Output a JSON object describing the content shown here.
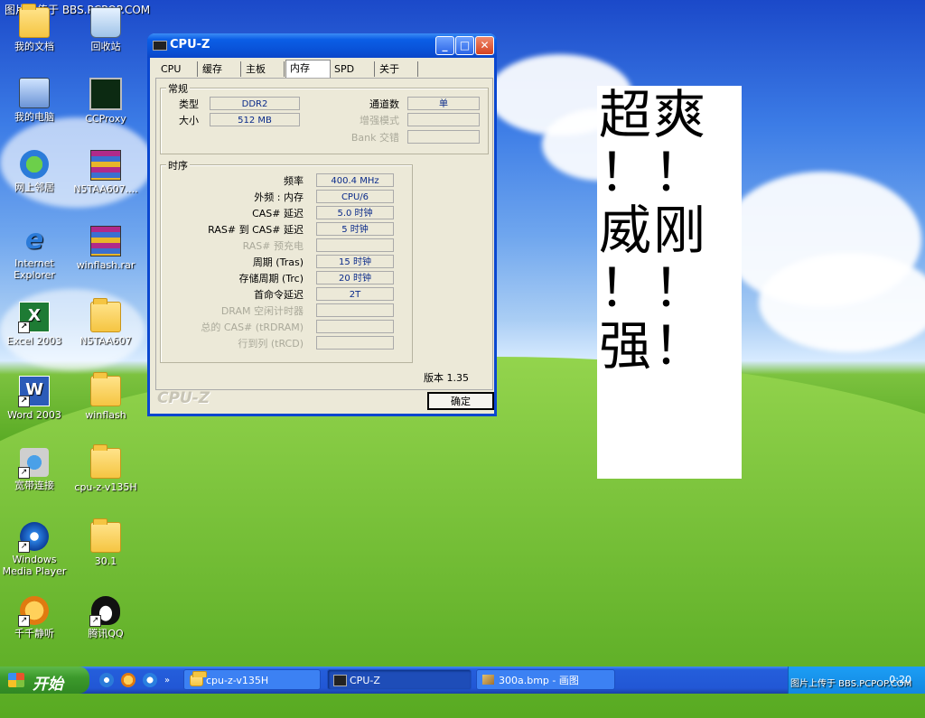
{
  "watermark_top": "图片上传于 BBS.PCPOP.COM",
  "desktop_icons": [
    {
      "label": "我的文档",
      "icon": "my-documents-icon"
    },
    {
      "label": "CCProxy",
      "icon": "ccproxy-icon"
    },
    {
      "label": "我的电脑",
      "icon": "my-computer-icon"
    },
    {
      "label": "N5TAA607....",
      "icon": "rar-archive-icon"
    },
    {
      "label": "网上邻居",
      "icon": "network-places-icon"
    },
    {
      "label": "winflash.rar",
      "icon": "rar-archive-icon"
    },
    {
      "label": "Internet Explorer",
      "icon": "internet-explorer-icon"
    },
    {
      "label": "N5TAA607",
      "icon": "folder-icon"
    },
    {
      "label": "Excel 2003",
      "icon": "excel-icon"
    },
    {
      "label": "winflash",
      "icon": "folder-icon"
    },
    {
      "label": "Word 2003",
      "icon": "word-icon"
    },
    {
      "label": "cpu-z-v135H",
      "icon": "folder-icon"
    },
    {
      "label": "宽带连接",
      "icon": "broadband-connection-icon"
    },
    {
      "label": "30.1",
      "icon": "folder-icon"
    },
    {
      "label": "Windows Media Player",
      "icon": "media-player-icon"
    },
    {
      "label": "腾讯QQ",
      "icon": "qq-penguin-icon"
    },
    {
      "label": "千千静听",
      "icon": "ttplayer-icon"
    },
    {
      "label": "回收站",
      "icon": "recycle-bin-icon"
    }
  ],
  "cpuz": {
    "title": "CPU-Z",
    "tabs": [
      "CPU",
      "缓存",
      "主板",
      "内存",
      "SPD",
      "关于"
    ],
    "active_tab": "内存",
    "general": {
      "group_label": "常规",
      "type_label": "类型",
      "type_value": "DDR2",
      "size_label": "大小",
      "size_value": "512 MB",
      "channels_label": "通道数",
      "channels_value": "单",
      "perf_mode_label": "增强模式",
      "perf_mode_value": "",
      "bank_label": "Bank 交错",
      "bank_value": ""
    },
    "timings": {
      "group_label": "时序",
      "rows": [
        {
          "label": "频率",
          "value": "400.4 MHz",
          "dim": false
        },
        {
          "label": "外频 : 内存",
          "value": "CPU/6",
          "dim": false
        },
        {
          "label": "CAS# 延迟",
          "value": "5.0 时钟",
          "dim": false
        },
        {
          "label": "RAS# 到 CAS# 延迟",
          "value": "5 时钟",
          "dim": false
        },
        {
          "label": "RAS# 预充电",
          "value": "",
          "dim": true
        },
        {
          "label": "周期 (Tras)",
          "value": "15 时钟",
          "dim": false
        },
        {
          "label": "存储周期 (Trc)",
          "value": "20 时钟",
          "dim": false
        },
        {
          "label": "首命令延迟",
          "value": "2T",
          "dim": false
        },
        {
          "label": "DRAM 空闲计时器",
          "value": "",
          "dim": true
        },
        {
          "label": "总的 CAS# (tRDRAM)",
          "value": "",
          "dim": true
        },
        {
          "label": "行到列 (tRCD)",
          "value": "",
          "dim": true
        }
      ]
    },
    "version": "版本 1.35",
    "logo": "CPU-Z",
    "ok_label": "确定"
  },
  "paint_text": [
    "超爽",
    "！！",
    "威刚",
    "！！",
    "强！"
  ],
  "taskbar": {
    "start_label": "开始",
    "tasks": [
      {
        "label": "cpu-z-v135H",
        "icon": "folder-icon",
        "active": false
      },
      {
        "label": "CPU-Z",
        "icon": "chip-icon",
        "active": true
      },
      {
        "label": "300a.bmp - 画图",
        "icon": "paint-icon",
        "active": false
      }
    ],
    "tray_watermark": "图片上传于 BBS.PCPOP.COM",
    "clock": "0:20"
  },
  "colors": {
    "title_blue": "#0a47d0",
    "taskbar_blue": "#245edb",
    "start_green": "#3c9a2c"
  }
}
